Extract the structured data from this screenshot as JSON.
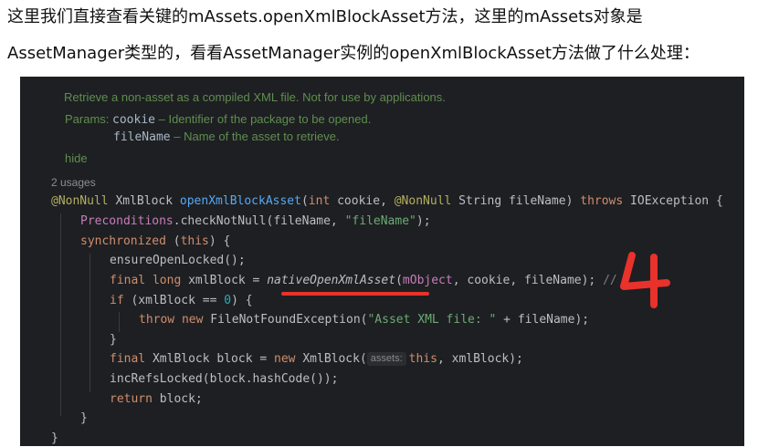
{
  "intro": {
    "line1": "这里我们直接查看关键的mAssets.openXmlBlockAsset方法，这里的mAssets对象是",
    "line2": "AssetManager类型的，看看AssetManager实例的openXmlBlockAsset方法做了什么处理："
  },
  "doc": {
    "summary": "Retrieve a non-asset as a compiled XML file. Not for use by applications.",
    "params_label": "Params:",
    "param1_name": "cookie",
    "param1_desc": " – Identifier of the package to be opened.",
    "param2_name": "fileName",
    "param2_desc": " – Name of the asset to retrieve.",
    "hide": "hide"
  },
  "usages": "2 usages",
  "code": {
    "l1": {
      "ann1": "@NonNull",
      "type": " XmlBlock ",
      "name": "openXmlBlockAsset",
      "p_open": "(",
      "kw_int": "int",
      "p_cookie": " cookie, ",
      "ann2": "@NonNull",
      "p_rest": " String fileName) ",
      "kw_throws": "throws",
      "ex": " IOException {"
    },
    "l2": {
      "cls": "Preconditions",
      "call": ".checkNotNull(fileName, ",
      "str": "\"fileName\"",
      "end": ");"
    },
    "l3": {
      "kw": "synchronized",
      "open": " (",
      "kw_this": "this",
      "close": ") {"
    },
    "l4": {
      "call": "ensureOpenLocked();"
    },
    "l5": {
      "kw_final": "final",
      "kw_long": " long",
      "decl": " xmlBlock = ",
      "native": "nativeOpenXmlAsset",
      "open": "(",
      "field": "mObject",
      "rest": ", cookie, fileName); ",
      "cmt": "//"
    },
    "l6": {
      "kw_if": "if",
      "cond": " (xmlBlock == ",
      "num": "0",
      "close": ") {"
    },
    "l7": {
      "kw_throw": "throw",
      "kw_new": " new",
      "ctor": " FileNotFoundException(",
      "str": "\"Asset XML file: \"",
      "rest": " + fileName);"
    },
    "l8": {
      "text": "}"
    },
    "l9": {
      "kw_final": "final",
      "type": " XmlBlock block = ",
      "kw_new": "new",
      "ctor": " XmlBlock(",
      "hint": "assets:",
      "kw_this": "this",
      "rest": ", xmlBlock);"
    },
    "l10": {
      "call": "incRefsLocked(block.hashCode());"
    },
    "l11": {
      "kw_return": "return",
      "rest": " block;"
    },
    "l12": {
      "text": "}"
    },
    "l13": {
      "text": "}"
    }
  },
  "annotation": {
    "number": "4",
    "color": "#e8322b"
  },
  "colors": {
    "editor_bg": "#1e1f22",
    "keyword": "#cf8e6d",
    "annotation": "#b3ae60",
    "string": "#6aab73",
    "function": "#56a8f5",
    "doc_comment": "#5f8e4f"
  }
}
